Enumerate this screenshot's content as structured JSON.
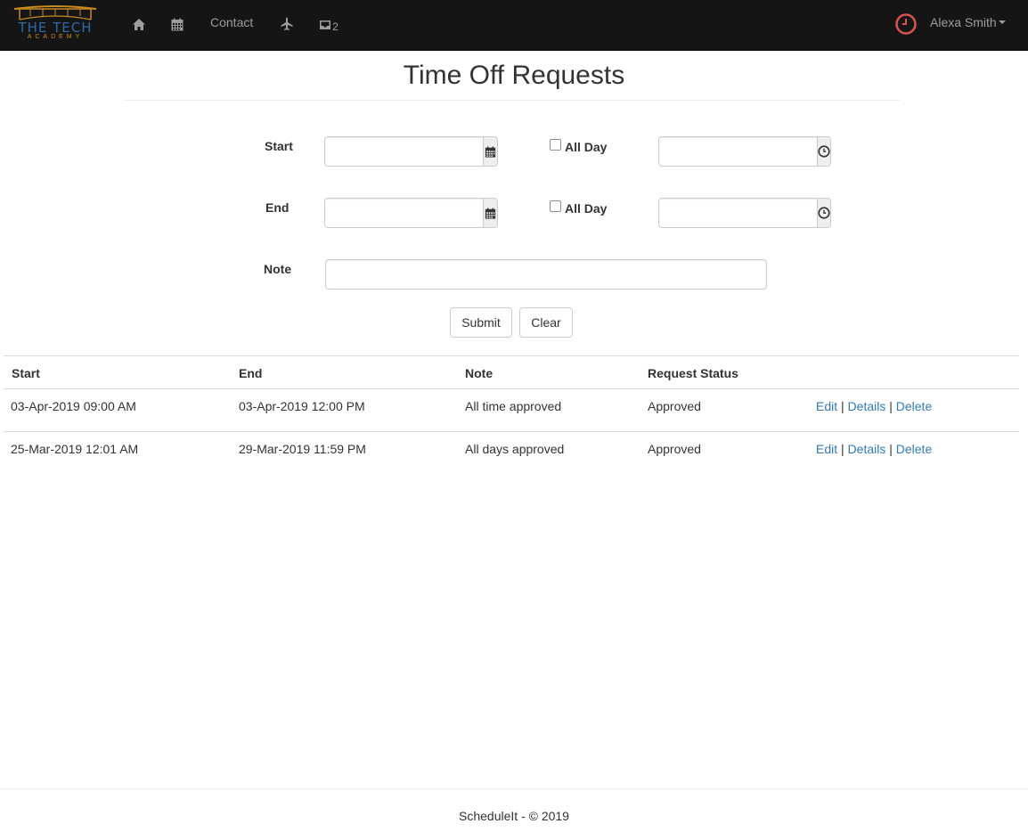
{
  "navbar": {
    "brand_text": "THE TECH",
    "brand_sub": "ACADEMY",
    "contact_label": "Contact",
    "messages_count": "2",
    "user_name": "Alexa Smith",
    "icons": [
      "home-icon",
      "calendar-icon",
      "plane-icon",
      "inbox-icon",
      "clock-icon"
    ]
  },
  "page": {
    "title": "Time Off Requests"
  },
  "form": {
    "start_label": "Start",
    "end_label": "End",
    "note_label": "Note",
    "all_day_label": "All Day",
    "start_date_value": "",
    "start_time_value": "",
    "end_date_value": "",
    "end_time_value": "",
    "note_value": "",
    "submit_label": "Submit",
    "clear_label": "Clear"
  },
  "table": {
    "headers": [
      "Start",
      "End",
      "Note",
      "Request Status"
    ],
    "rows": [
      {
        "start": "03-Apr-2019 09:00 AM",
        "end": "03-Apr-2019 12:00 PM",
        "note": "All time approved",
        "status": "Approved",
        "edit": "Edit",
        "details": "Details",
        "delete": "Delete"
      },
      {
        "start": "25-Mar-2019 12:01 AM",
        "end": "29-Mar-2019 11:59 PM",
        "note": "All days approved",
        "status": "Approved",
        "edit": "Edit",
        "details": "Details",
        "delete": "Delete"
      }
    ],
    "separator": "|"
  },
  "footer": {
    "text": "ScheduleIt - © 2019"
  },
  "colors": {
    "navbar_bg": "#151515",
    "brand_blue": "#2a6aa8",
    "brand_gold": "#c98a1e",
    "link": "#337ab7",
    "clock_red": "#d9534f"
  }
}
